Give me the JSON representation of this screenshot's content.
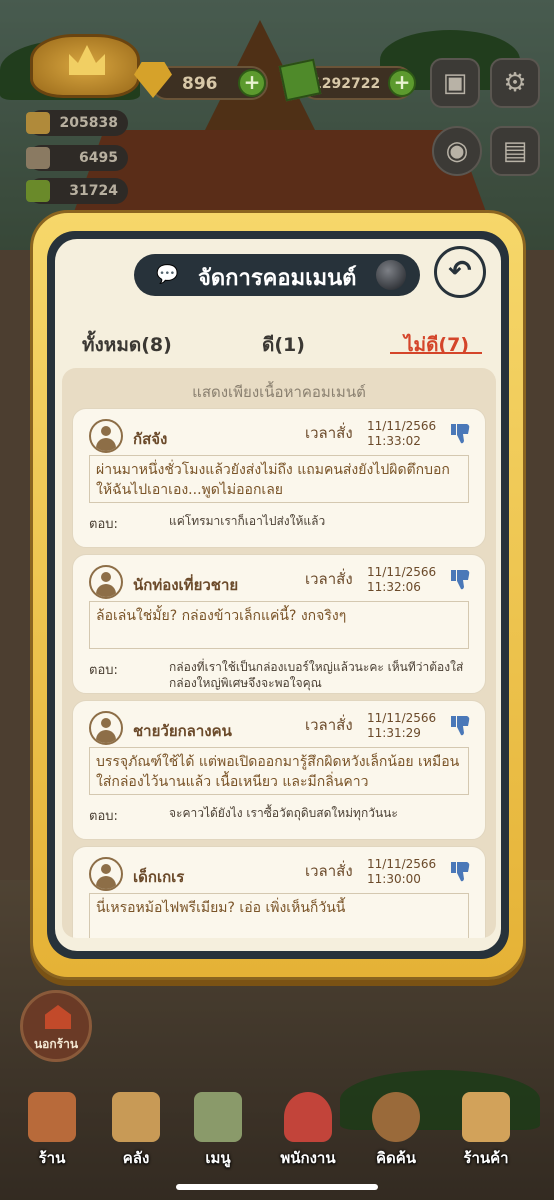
{
  "hud": {
    "gems": "896",
    "cash": "1292722",
    "stats": [
      "205838",
      "6495",
      "31724"
    ],
    "plus_label": "+"
  },
  "dialog": {
    "title": "จัดการคอมเมนต์",
    "tabs": [
      "ทั้งหมด(8)",
      "ดี(1)",
      "ไม่ดี(7)"
    ],
    "active_tab_index": 2,
    "list_header": "แสดงเพียงเนื้อหาคอมเมนต์",
    "time_label": "เวลาสั่ง",
    "reply_label": "ตอบ:",
    "comments": [
      {
        "name": "กัสจัง",
        "date": "11/11/2566",
        "time": "11:33:02",
        "text": "ผ่านมาหนึ่งชั่วโมงแล้วยังส่งไม่ถึง แถมคนส่งยังไปผิดตึกบอกให้ฉันไปเอาเอง...พูดไม่ออกเลย",
        "reply": "แค่โทรมาเราก็เอาไปส่งให้แล้ว"
      },
      {
        "name": "นักท่องเที่ยวชาย",
        "date": "11/11/2566",
        "time": "11:32:06",
        "text": "ล้อเล่นใช่มั้ย? กล่องข้าวเล็กแค่นี้? งกจริงๆ",
        "reply": "กล่องที่เราใช้เป็นกล่องเบอร์ใหญ่แล้วนะคะ เห็นทีว่าต้องใส่กล่องใหญ่พิเศษจึงจะพอใจคุณ"
      },
      {
        "name": "ชายวัยกลางคน",
        "date": "11/11/2566",
        "time": "11:31:29",
        "text": "บรรจุภัณฑ์ใช้ได้ แต่พอเปิดออกมารู้สึกผิดหวังเล็กน้อย เหมือนใส่กล่องไว้นานแล้ว เนื้อเหนียว และมีกลิ่นคาว",
        "reply": "จะคาวได้ยังไง เราซื้อวัตถุดิบสดใหม่ทุกวันนะ"
      },
      {
        "name": "เด็กเกเร",
        "date": "11/11/2566",
        "time": "11:30:00",
        "text": "นี่เหรอหม้อไฟพรีเมียม? เอ่อ เพิ่งเห็นก็วันนี้",
        "reply": ""
      }
    ]
  },
  "nav": {
    "outside": "นอกร้าน",
    "items": [
      "ร้าน",
      "คลัง",
      "เมนู",
      "พนักงาน",
      "คิดค้น",
      "ร้านค้า"
    ]
  },
  "colors": {
    "frame": "#e5b236",
    "dark": "#27323a",
    "accent_red": "#d4452a",
    "thumb_blue": "#4a78b8"
  }
}
